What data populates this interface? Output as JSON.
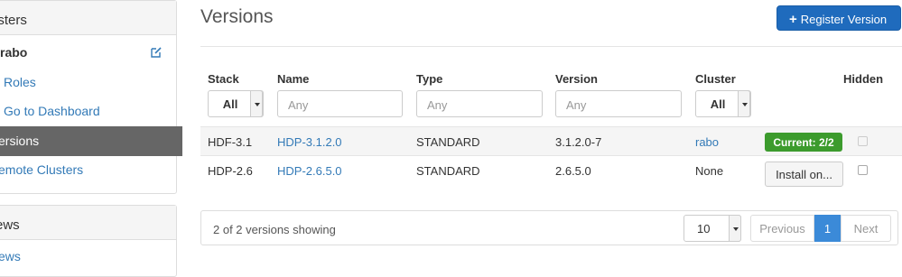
{
  "sidebar": {
    "clusters_header": "usters",
    "cluster_name": "rabo",
    "items": [
      {
        "label": "Roles"
      },
      {
        "label": "Go to Dashboard"
      },
      {
        "label": "ersions"
      },
      {
        "label": "emote Clusters"
      }
    ],
    "views_header": "ews",
    "views_item": "ews"
  },
  "main": {
    "title": "Versions",
    "register_button": "Register Version",
    "columns": {
      "stack": "Stack",
      "name": "Name",
      "type": "Type",
      "version": "Version",
      "cluster": "Cluster",
      "hidden": "Hidden"
    },
    "filters": {
      "stack_value": "All",
      "name_placeholder": "Any",
      "type_placeholder": "Any",
      "version_placeholder": "Any",
      "cluster_value": "All"
    },
    "rows": [
      {
        "stack": "HDF-3.1",
        "name": "HDP-3.1.2.0",
        "type": "STANDARD",
        "version": "3.1.2.0-7",
        "cluster": "rabo",
        "status": "Current: 2/2"
      },
      {
        "stack": "HDP-2.6",
        "name": "HDP-2.6.5.0",
        "type": "STANDARD",
        "version": "2.6.5.0",
        "cluster": "None",
        "action": "Install on..."
      }
    ],
    "footer": {
      "count": "2 of 2 versions showing",
      "page_size": "10",
      "previous": "Previous",
      "current_page": "1",
      "next": "Next"
    }
  },
  "colors": {
    "primary": "#1f6bbd",
    "success": "#3c9b2d",
    "link": "#337ab7",
    "active_nav": "#666666"
  }
}
